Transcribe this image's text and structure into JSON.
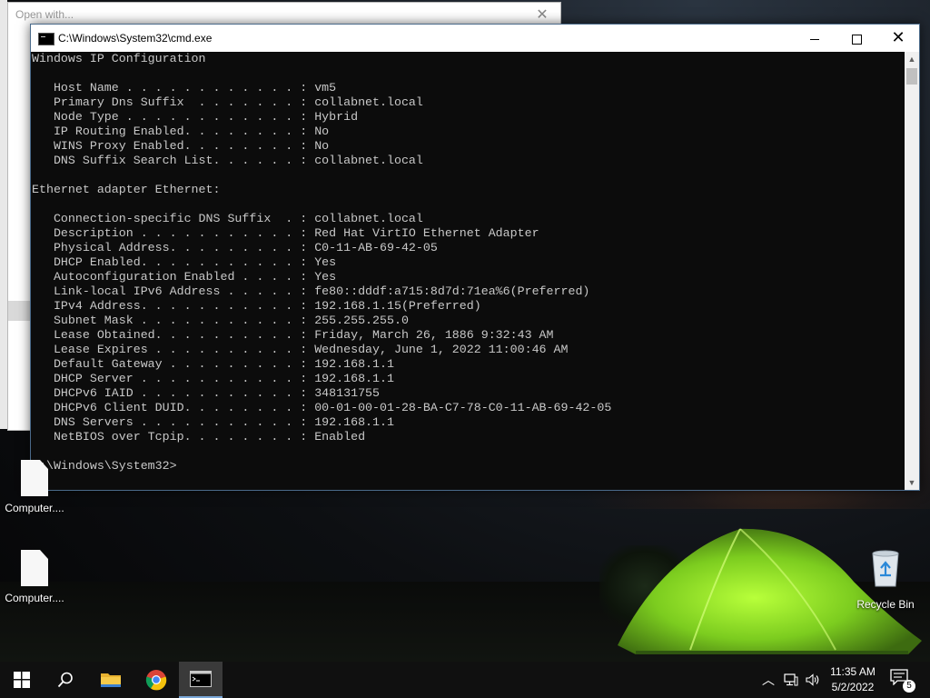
{
  "background_window": {
    "title": "Open with..."
  },
  "cmd_window": {
    "title": "C:\\Windows\\System32\\cmd.exe",
    "lines": [
      "Windows IP Configuration",
      "",
      "   Host Name . . . . . . . . . . . . : vm5",
      "   Primary Dns Suffix  . . . . . . . : collabnet.local",
      "   Node Type . . . . . . . . . . . . : Hybrid",
      "   IP Routing Enabled. . . . . . . . : No",
      "   WINS Proxy Enabled. . . . . . . . : No",
      "   DNS Suffix Search List. . . . . . : collabnet.local",
      "",
      "Ethernet adapter Ethernet:",
      "",
      "   Connection-specific DNS Suffix  . : collabnet.local",
      "   Description . . . . . . . . . . . : Red Hat VirtIO Ethernet Adapter",
      "   Physical Address. . . . . . . . . : C0-11-AB-69-42-05",
      "   DHCP Enabled. . . . . . . . . . . : Yes",
      "   Autoconfiguration Enabled . . . . : Yes",
      "   Link-local IPv6 Address . . . . . : fe80::dddf:a715:8d7d:71ea%6(Preferred)",
      "   IPv4 Address. . . . . . . . . . . : 192.168.1.15(Preferred)",
      "   Subnet Mask . . . . . . . . . . . : 255.255.255.0",
      "   Lease Obtained. . . . . . . . . . : Friday, March 26, 1886 9:32:43 AM",
      "   Lease Expires . . . . . . . . . . : Wednesday, June 1, 2022 11:00:46 AM",
      "   Default Gateway . . . . . . . . . : 192.168.1.1",
      "   DHCP Server . . . . . . . . . . . : 192.168.1.1",
      "   DHCPv6 IAID . . . . . . . . . . . : 348131755",
      "   DHCPv6 Client DUID. . . . . . . . : 00-01-00-01-28-BA-C7-78-C0-11-AB-69-42-05",
      "   DNS Servers . . . . . . . . . . . : 192.168.1.1",
      "   NetBIOS over Tcpip. . . . . . . . : Enabled",
      "",
      "C:\\Windows\\System32>"
    ]
  },
  "desktop_icons": [
    {
      "label": "Computer....",
      "icon": "file-icon"
    },
    {
      "label": "Computer....",
      "icon": "file-icon"
    },
    {
      "label": "Recycle Bin",
      "icon": "recycle-bin-icon"
    }
  ],
  "taskbar": {
    "buttons": [
      {
        "name": "start",
        "icon": "windows-logo-icon"
      },
      {
        "name": "search",
        "icon": "search-icon"
      },
      {
        "name": "file-explorer",
        "icon": "folder-icon"
      },
      {
        "name": "chrome",
        "icon": "chrome-icon"
      },
      {
        "name": "cmd",
        "icon": "terminal-icon",
        "active": true
      }
    ],
    "clock": {
      "time": "11:35 AM",
      "date": "5/2/2022"
    },
    "notification_count": "5"
  },
  "colors": {
    "console_bg": "#0c0c0c",
    "console_fg": "#c8c8c8",
    "taskbar_bg": "#101010",
    "tent_green": "#8ee02a",
    "active_indicator": "#7aa7d8"
  }
}
